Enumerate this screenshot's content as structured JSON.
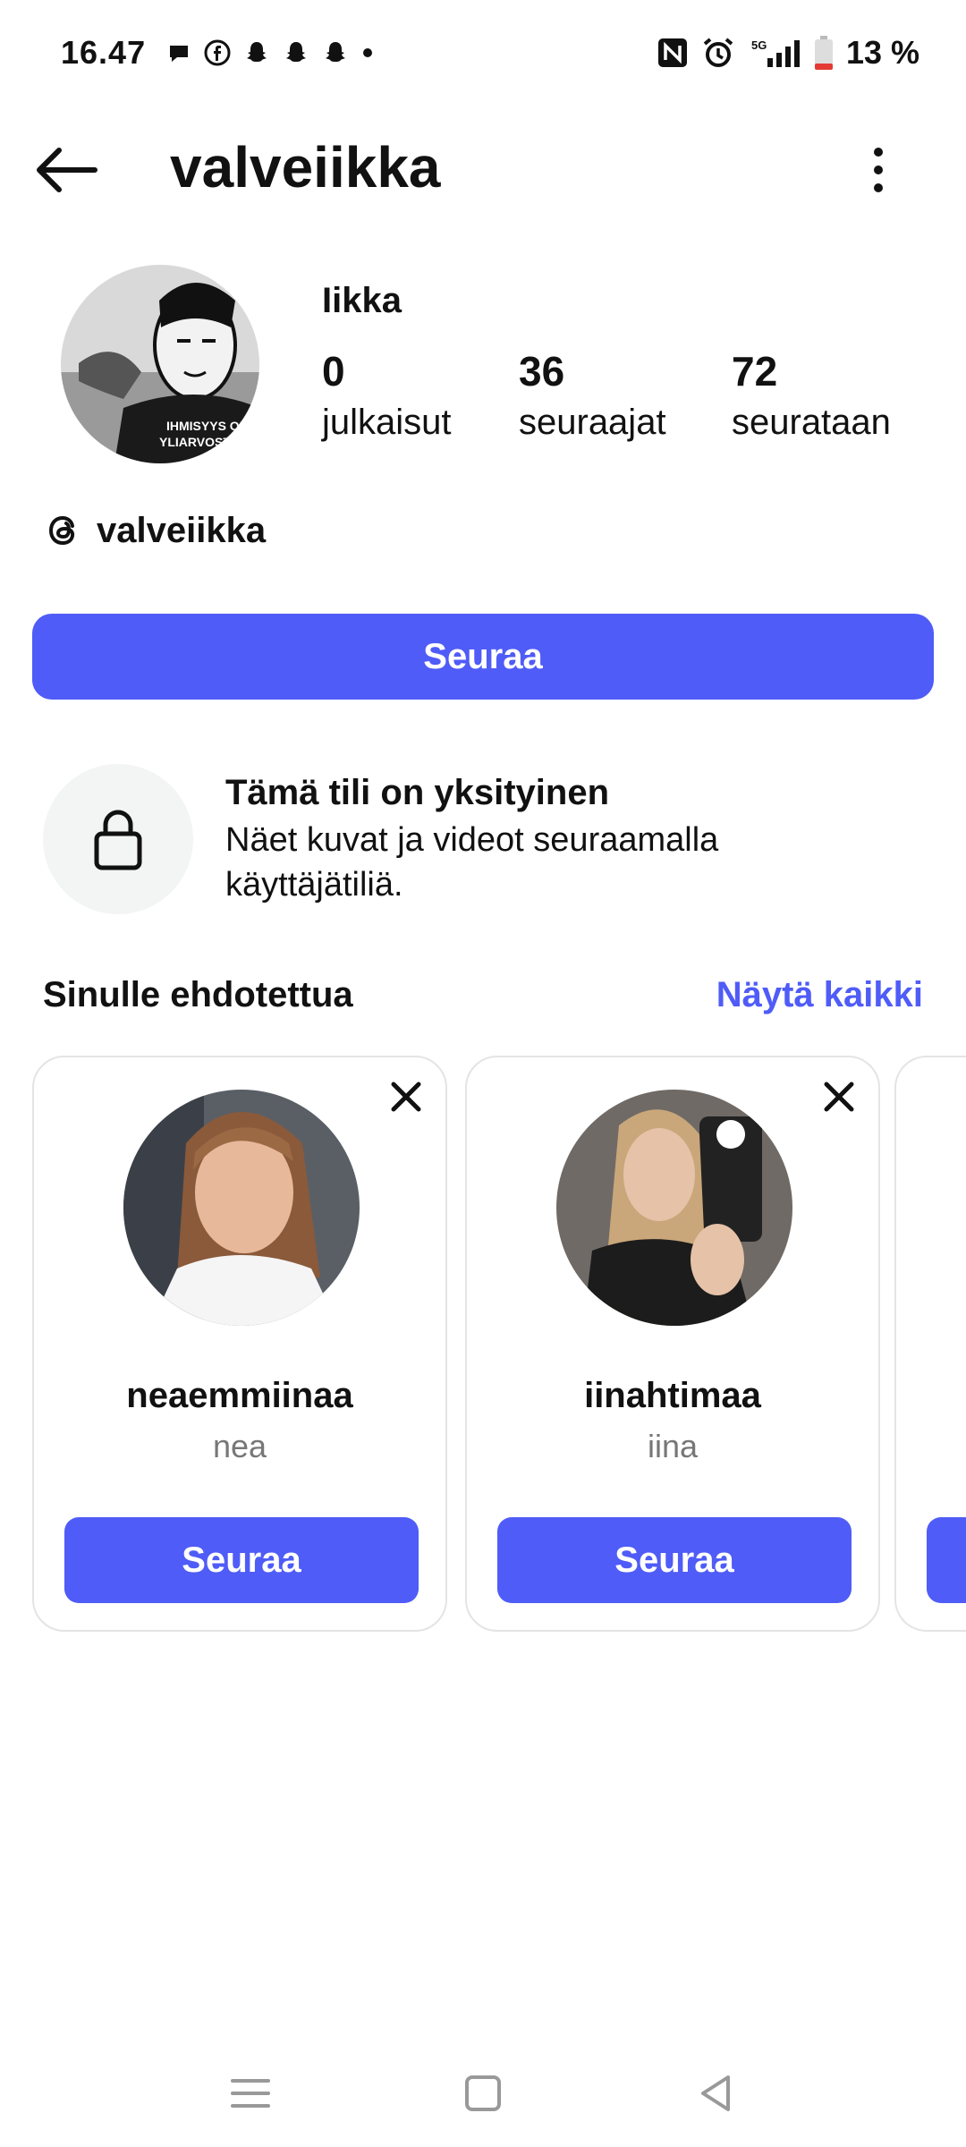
{
  "status_bar": {
    "time": "16.47",
    "battery": "13 %",
    "network": "5G"
  },
  "header": {
    "username": "valveiikka"
  },
  "profile": {
    "display_name": "Iikka",
    "stats": [
      {
        "value": "0",
        "label": "julkaisut"
      },
      {
        "value": "36",
        "label": "seuraajat"
      },
      {
        "value": "72",
        "label": "seurataan"
      }
    ],
    "threads_handle": "valveiikka",
    "follow_label": "Seuraa"
  },
  "private_notice": {
    "title": "Tämä tili on yksityinen",
    "description": "Näet kuvat ja videot seuraamalla käyttäjätiliä."
  },
  "suggestions": {
    "title": "Sinulle ehdotettua",
    "see_all": "Näytä kaikki",
    "cards": [
      {
        "username": "neaemmiinaa",
        "name": "nea",
        "button": "Seuraa"
      },
      {
        "username": "iinahtimaa",
        "name": "iina",
        "button": "Seuraa"
      }
    ]
  },
  "colors": {
    "accent": "#4f5cf7",
    "battery_low": "#e53935"
  },
  "icons": [
    "back-arrow-icon",
    "more-vertical-icon",
    "threads-icon",
    "lock-icon",
    "close-icon",
    "menu-icon",
    "home-square-icon",
    "back-triangle-icon"
  ]
}
